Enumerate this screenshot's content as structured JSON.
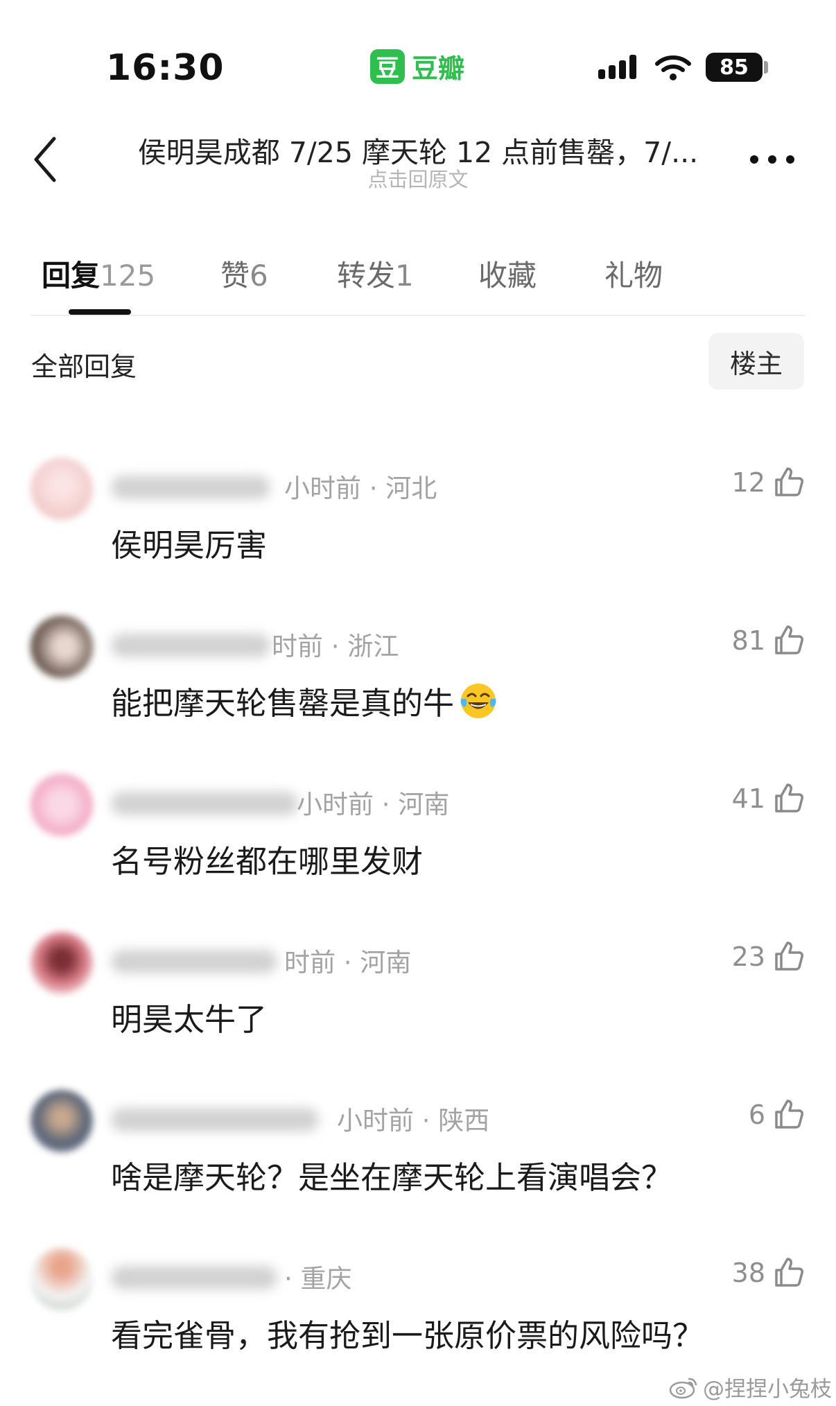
{
  "status_bar": {
    "time": "16:30",
    "app_logo_char": "豆",
    "app_name": "豆瓣",
    "battery": "85",
    "brand_color": "#2fbf4e"
  },
  "header": {
    "title": "侯明昊成都 7/25 摩天轮 12 点前售罄，7/...",
    "subtitle": "点击回原文",
    "back_icon": "chevron-left-icon",
    "more_icon": "more-horizontal-icon"
  },
  "tabs": [
    {
      "label": "回复",
      "count": "125",
      "active": true
    },
    {
      "label": "赞",
      "count": "6",
      "active": false
    },
    {
      "label": "转发",
      "count": "1",
      "active": false
    },
    {
      "label": "收藏",
      "count": "",
      "active": false
    },
    {
      "label": "礼物",
      "count": "",
      "active": false
    }
  ],
  "filter": {
    "label": "全部回复",
    "op_button": "楼主"
  },
  "comments": [
    {
      "meta": "小时前 · 河北",
      "text": "侯明昊厉害",
      "likes": "12",
      "avatar_color": "#f2c9c9"
    },
    {
      "meta": "时前 · 浙江",
      "text": "能把摩天轮售罄是真的牛",
      "emoji": "tears-of-joy-emoji",
      "likes": "81",
      "avatar_color": "#6b5a50"
    },
    {
      "meta": "小时前 · 河南",
      "text": "名号粉丝都在哪里发财",
      "likes": "41",
      "avatar_color": "#f2a7c3"
    },
    {
      "meta": "时前 · 河南",
      "text": "明昊太牛了",
      "likes": "23",
      "avatar_color": "#d77a85"
    },
    {
      "meta": "小时前 · 陕西",
      "text": "啥是摩天轮？是坐在摩天轮上看演唱会？",
      "likes": "6",
      "avatar_color": "#5a6578"
    },
    {
      "meta": "· 重庆",
      "text": "看完雀骨，我有抢到一张原价票的风险吗？",
      "likes": "38",
      "avatar_color": "#e9a58c"
    }
  ],
  "watermark": {
    "text": "@捏捏小兔枝",
    "icon": "weibo-icon"
  }
}
